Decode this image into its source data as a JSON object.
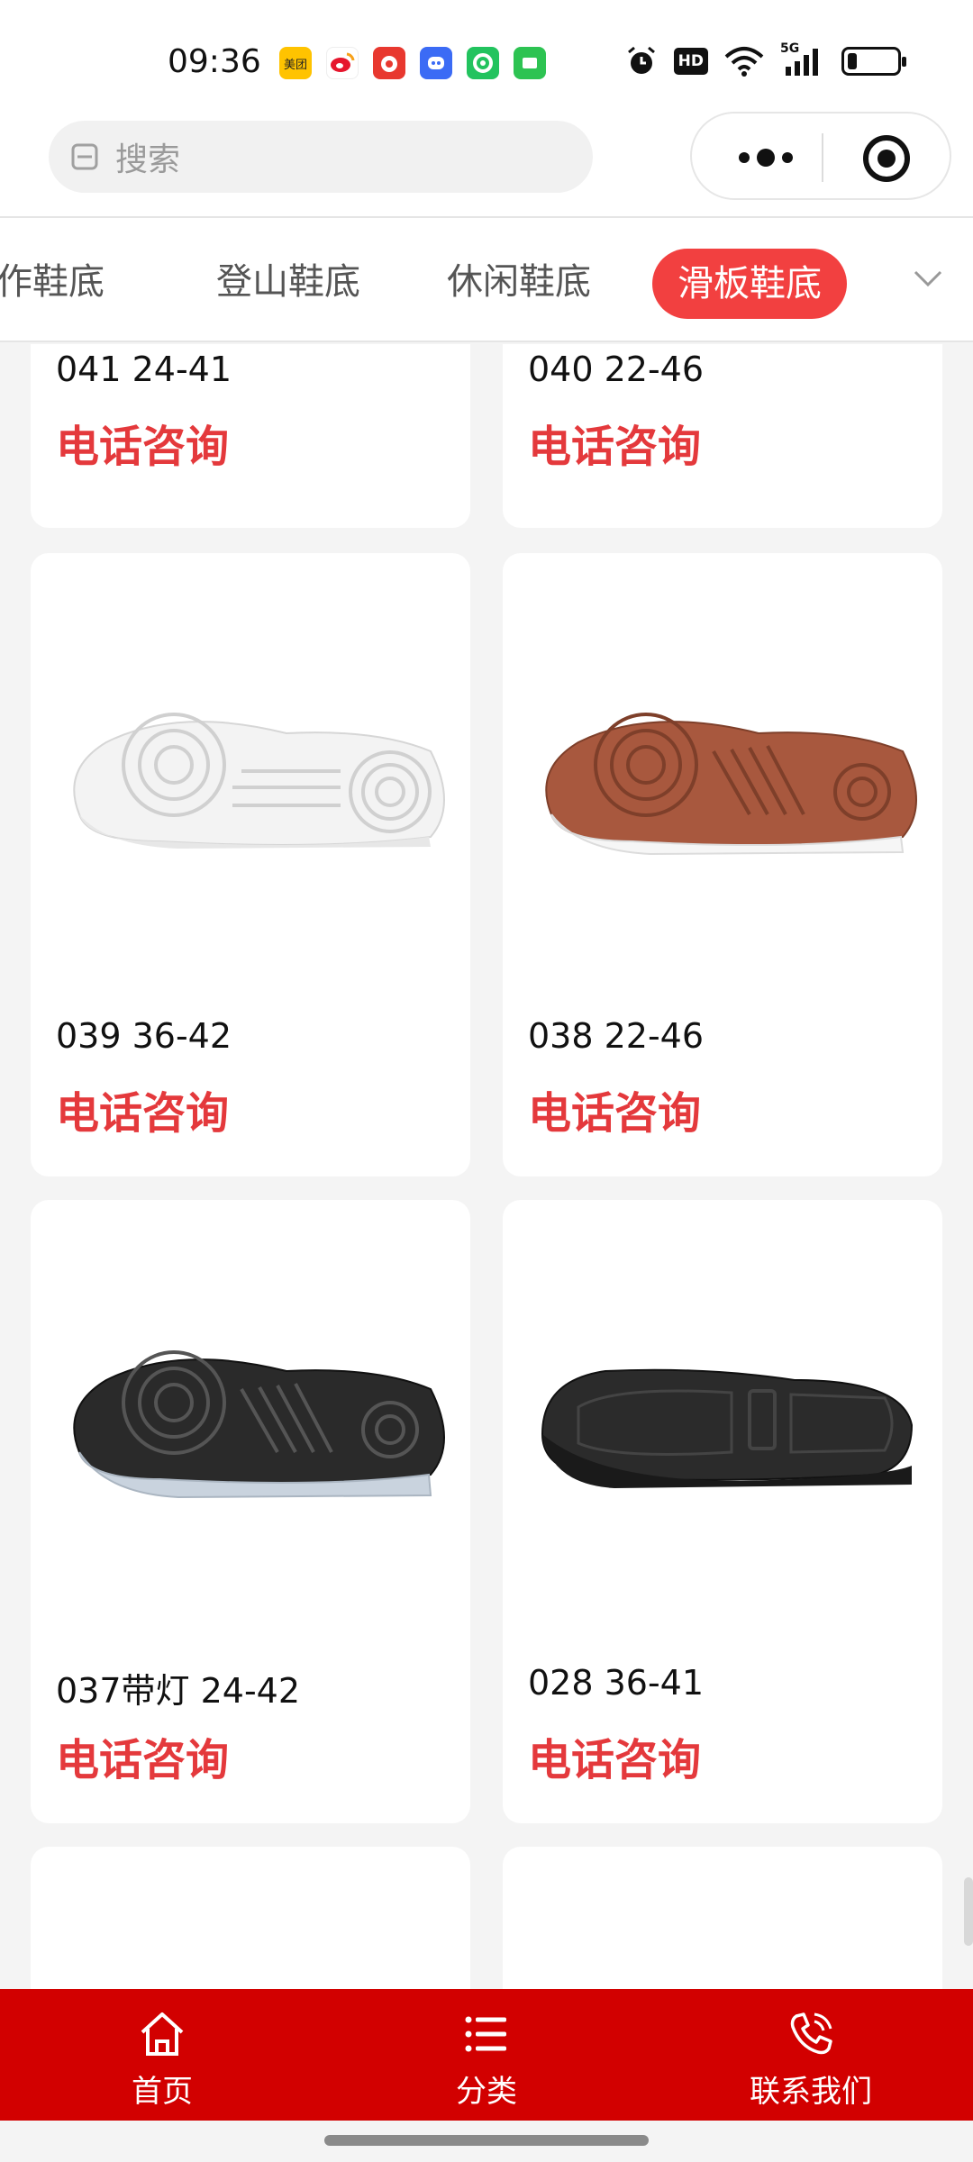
{
  "status_bar": {
    "time": "09:36",
    "app_icons": [
      {
        "name": "meituan-icon",
        "label": "美团",
        "color": "#ffc300"
      },
      {
        "name": "weibo-icon",
        "label": "",
        "color": "#ffffff"
      },
      {
        "name": "red-app-icon",
        "label": "",
        "color": "#e8382f"
      },
      {
        "name": "qq-icon",
        "label": "",
        "color": "#3b6bf5"
      },
      {
        "name": "green-app-icon",
        "label": "",
        "color": "#22c35e"
      },
      {
        "name": "iqiyi-icon",
        "label": "",
        "color": "#2dc352"
      }
    ],
    "hd_label": "HD",
    "network_label": "5G"
  },
  "header": {
    "search_placeholder": "搜索"
  },
  "tabs": {
    "items": [
      {
        "label": "作鞋底",
        "active": false
      },
      {
        "label": "登山鞋底",
        "active": false
      },
      {
        "label": "休闲鞋底",
        "active": false
      },
      {
        "label": "滑板鞋底",
        "active": true
      }
    ]
  },
  "products": [
    {
      "name": "041 24-41",
      "price_label": "电话咨询",
      "sole_color": "#ffffff"
    },
    {
      "name": "040 22-46",
      "price_label": "电话咨询",
      "sole_color": "#ffffff"
    },
    {
      "name": "039 36-42",
      "price_label": "电话咨询",
      "sole_color": "#f5f5f5"
    },
    {
      "name": "038 22-46",
      "price_label": "电话咨询",
      "sole_color": "#a8583e"
    },
    {
      "name": "037带灯 24-42",
      "price_label": "电话咨询",
      "sole_color": "#222222"
    },
    {
      "name": "028 36-41",
      "price_label": "电话咨询",
      "sole_color": "#1f1f1f"
    }
  ],
  "bottom_nav": {
    "items": [
      {
        "label": "首页"
      },
      {
        "label": "分类"
      },
      {
        "label": "联系我们"
      }
    ]
  },
  "colors": {
    "accent": "#f24040",
    "price": "#e4393c",
    "nav_bg": "#d20000"
  }
}
